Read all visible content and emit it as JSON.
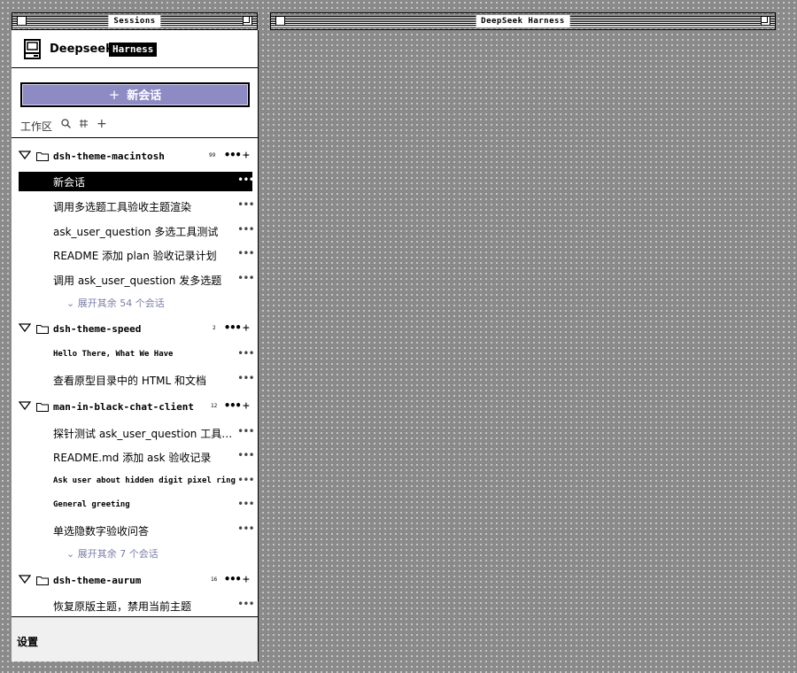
{
  "left_window": {
    "title": "Sessions"
  },
  "right_window": {
    "title": "DeepSeek Harness"
  },
  "brand": {
    "name": "Deepseek",
    "badge": "Harness"
  },
  "new_chat": {
    "label": "新会话",
    "plus": "+"
  },
  "workspace": {
    "label": "工作区",
    "search_icon": "search-icon",
    "filter_icon": "filter-icon",
    "add": "+"
  },
  "groups": [
    {
      "name": "dsh-theme-macintosh",
      "count": "99",
      "more": "•••",
      "add": "+",
      "sessions": [
        {
          "label": "新会话",
          "more": "•••"
        },
        {
          "label": "调用多选题工具验收主题渲染",
          "more": "•••"
        },
        {
          "label": "ask_user_question 多选工具测试",
          "more": "•••"
        },
        {
          "label": "README 添加 plan 验收记录计划",
          "more": "•••"
        },
        {
          "label": "调用 ask_user_question 发多选题",
          "more": "•••"
        }
      ],
      "expand": "展开其余 54 个会话"
    },
    {
      "name": "dsh-theme-speed",
      "count": "2",
      "more": "•••",
      "add": "+",
      "sessions": [
        {
          "label": "Hello There, What We Have",
          "more": "•••"
        },
        {
          "label": "查看原型目录中的 HTML 和文档",
          "more": "•••"
        }
      ]
    },
    {
      "name": "man-in-black-chat-client",
      "count": "12",
      "more": "•••",
      "add": "+",
      "sessions": [
        {
          "label": "探针测试 ask_user_question 工具…",
          "more": "•••"
        },
        {
          "label": "README.md 添加 ask 验收记录",
          "more": "•••"
        },
        {
          "label": "Ask user about hidden digit pixel ring",
          "more": "•••"
        },
        {
          "label": "General greeting",
          "more": "•••"
        },
        {
          "label": "单选隐数字验收问答",
          "more": "•••"
        }
      ],
      "expand": "展开其余 7 个会话"
    },
    {
      "name": "dsh-theme-aurum",
      "count": "16",
      "more": "•••",
      "add": "+",
      "sessions": [
        {
          "label": "恢复原版主题，禁用当前主题",
          "more": "•••"
        }
      ]
    }
  ],
  "footer": {
    "settings": "设置"
  }
}
